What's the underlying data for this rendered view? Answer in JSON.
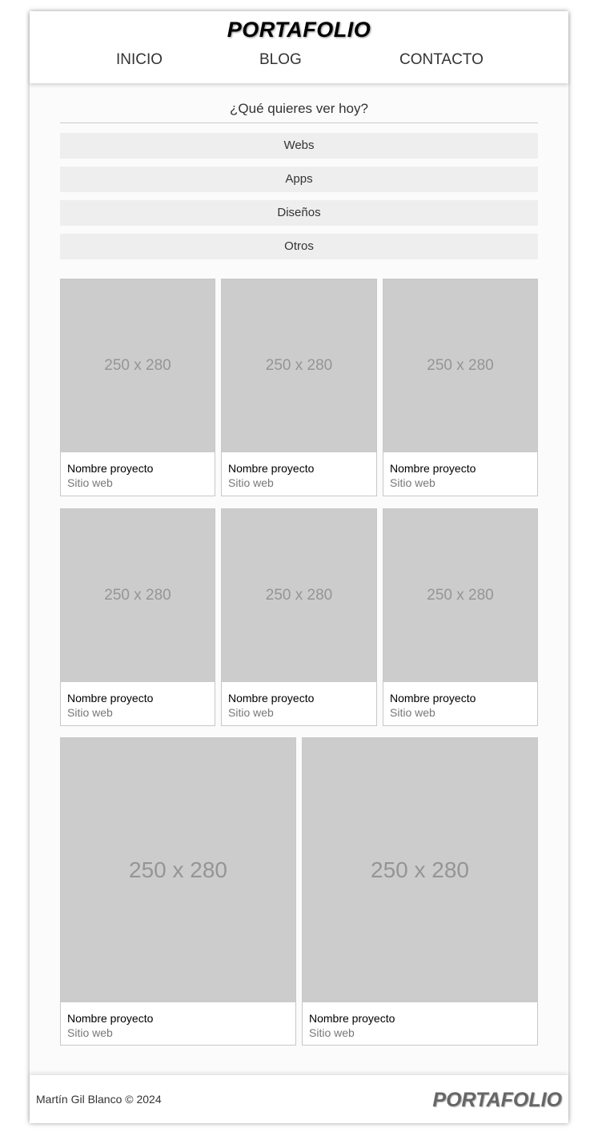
{
  "header": {
    "logo": "PORTAFOLIO",
    "nav": [
      "INICIO",
      "BLOG",
      "CONTACTO"
    ]
  },
  "filters": {
    "question": "¿Qué quieres ver hoy?",
    "options": [
      "Webs",
      "Apps",
      "Diseños",
      "Otros"
    ]
  },
  "projects": [
    {
      "thumb": "250 x 280",
      "name": "Nombre proyecto",
      "type": "Sitio web"
    },
    {
      "thumb": "250 x 280",
      "name": "Nombre proyecto",
      "type": "Sitio web"
    },
    {
      "thumb": "250 x 280",
      "name": "Nombre proyecto",
      "type": "Sitio web"
    },
    {
      "thumb": "250 x 280",
      "name": "Nombre proyecto",
      "type": "Sitio web"
    },
    {
      "thumb": "250 x 280",
      "name": "Nombre proyecto",
      "type": "Sitio web"
    },
    {
      "thumb": "250 x 280",
      "name": "Nombre proyecto",
      "type": "Sitio web"
    },
    {
      "thumb": "250 x 280",
      "name": "Nombre proyecto",
      "type": "Sitio web"
    },
    {
      "thumb": "250 x 280",
      "name": "Nombre proyecto",
      "type": "Sitio web"
    }
  ],
  "footer": {
    "credit": "Martín Gil Blanco © 2024",
    "logo": "PORTAFOLIO"
  }
}
